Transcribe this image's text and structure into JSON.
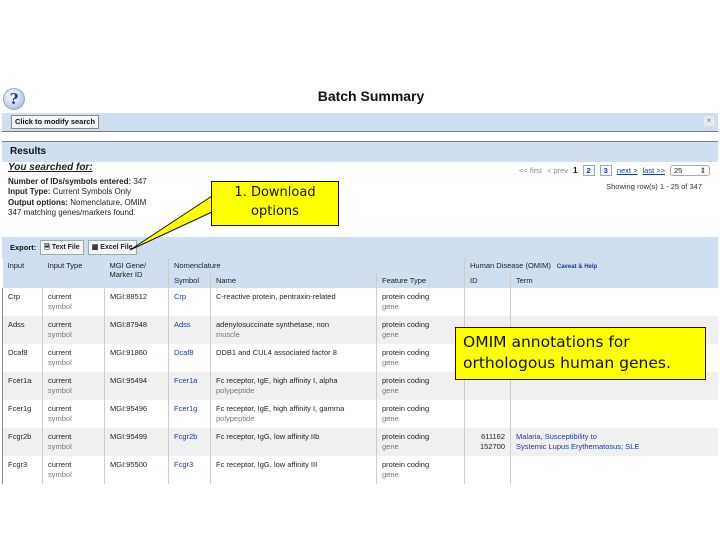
{
  "header": {
    "help_icon": "?",
    "title": "Batch Summary"
  },
  "modify_bar": {
    "button_label": "Click to modify search",
    "close_icon": "×"
  },
  "results_bar": {
    "label": "Results"
  },
  "summary": {
    "heading": "You searched for:",
    "lines": [
      {
        "label": "Number of IDs/symbols entered:",
        "value": "347"
      },
      {
        "label": "Input Type:",
        "value": "Current Symbols Only"
      },
      {
        "label": "Output options:",
        "value": "Nomenclature, OMIM"
      }
    ],
    "found": "347 matching genes/markers found."
  },
  "pager": {
    "first": "<< first",
    "prev": "< prev",
    "current": "1",
    "pages": [
      "2",
      "3"
    ],
    "next": "next >",
    "last": "last >>",
    "page_size": "25",
    "page_size_arrow": "⇕",
    "showing": "Showing row(s) 1 - 25 of 347"
  },
  "export": {
    "label": "Export:",
    "text_file": "Text File",
    "excel_file": "Excel File"
  },
  "table": {
    "headers": {
      "input": "Input",
      "input_type": "Input Type",
      "mgi_id": "MGI Gene/ Marker ID",
      "nomenclature": "Nomenclature",
      "symbol": "Symbol",
      "name": "Name",
      "feature_type": "Feature Type",
      "omim": "Human Disease (OMIM)",
      "caveat": "Caveat & Help",
      "omim_id": "ID",
      "omim_term": "Term"
    },
    "rows": [
      {
        "input": "Crp",
        "type": "current",
        "type2": "symbol",
        "mgi": "MGI:88512",
        "symbol": "Crp",
        "name": "C-reactive protein, pentraxin-related",
        "name2": "",
        "ft": "protein coding",
        "ft2": "gene",
        "omim_id": "",
        "omim_term": ""
      },
      {
        "input": "Adss",
        "type": "current",
        "type2": "symbol",
        "mgi": "MGI:87948",
        "symbol": "Adss",
        "name": "adenylosuccinate synthetase, non",
        "name2": "muscle",
        "ft": "protein coding",
        "ft2": "gene",
        "omim_id": "",
        "omim_term": ""
      },
      {
        "input": "Dcaf8",
        "type": "current",
        "type2": "symbol",
        "mgi": "MGI:91860",
        "symbol": "Dcaf8",
        "name": "DDB1 and CUL4 associated factor 8",
        "name2": "",
        "ft": "protein coding",
        "ft2": "gene",
        "omim_id": "",
        "omim_term": ""
      },
      {
        "input": "Fcer1a",
        "type": "current",
        "type2": "symbol",
        "mgi": "MGI:95494",
        "symbol": "Fcer1a",
        "name": "Fc receptor, IgE, high affinity I, alpha",
        "name2": "polypeptide",
        "ft": "protein coding",
        "ft2": "gene",
        "omim_id": "",
        "omim_term": ""
      },
      {
        "input": "Fcer1g",
        "type": "current",
        "type2": "symbol",
        "mgi": "MGI:95496",
        "symbol": "Fcer1g",
        "name": "Fc receptor, IgE, high affinity I, gamma",
        "name2": "polypeptide",
        "ft": "protein coding",
        "ft2": "gene",
        "omim_id": "",
        "omim_term": ""
      },
      {
        "input": "Fcgr2b",
        "type": "current",
        "type2": "symbol",
        "mgi": "MGI:95499",
        "symbol": "Fcgr2b",
        "name": "Fc receptor, IgG, low affinity IIb",
        "name2": "",
        "ft": "protein coding",
        "ft2": "gene",
        "omim_id": "611162",
        "omim_id2": "152700",
        "omim_term": "Malaria, Susceptibility to",
        "omim_term2": "Systemic Lupus Erythematosus; SLE"
      },
      {
        "input": "Fcgr3",
        "type": "current",
        "type2": "symbol",
        "mgi": "MGI:95500",
        "symbol": "Fcgr3",
        "name": "Fc receptor, IgG, low affinity III",
        "name2": "",
        "ft": "protein coding",
        "ft2": "gene",
        "omim_id": "",
        "omim_term": ""
      }
    ]
  },
  "callouts": {
    "download": [
      "1. Download",
      "options"
    ],
    "omim": [
      "OMIM annotations for",
      "orthologous human genes."
    ]
  }
}
